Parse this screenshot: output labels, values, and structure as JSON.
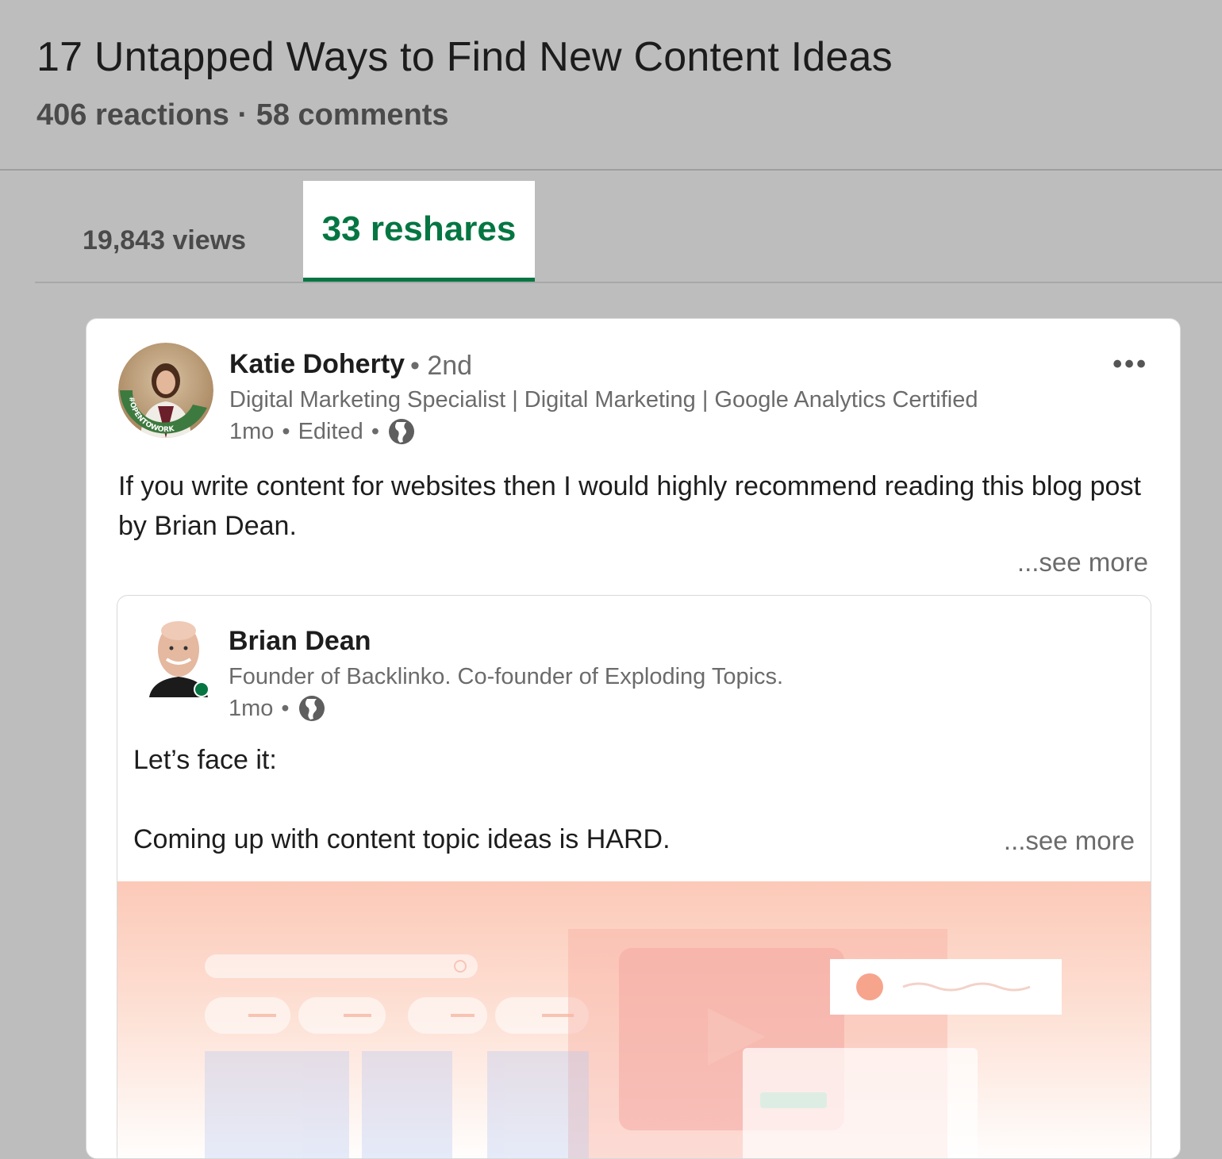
{
  "article": {
    "title": "17 Untapped Ways to Find New Content Ideas",
    "stats": "406 reactions · 58 comments"
  },
  "tabs": {
    "views_label": "19,843 views",
    "reshares_label": "33 reshares",
    "active": "reshares",
    "accent_color": "#057642"
  },
  "reshare": {
    "author": {
      "name": "Katie Doherty",
      "degree": "• 2nd",
      "headline": "Digital Marketing Specialist | Digital Marketing | Google Analytics Certified",
      "time": "1mo",
      "edited": "Edited",
      "badge": "#OPENTOWORK"
    },
    "body": "If you write content for websites then I would highly recommend reading this blog post by Brian Dean.",
    "see_more": "...see more",
    "menu_icon": "more-horizontal-icon",
    "visibility_icon": "globe-icon"
  },
  "shared_post": {
    "author": {
      "name": "Brian Dean",
      "headline": "Founder of Backlinko. Co-founder of Exploding Topics.",
      "time": "1mo",
      "online_status_color": "#057642"
    },
    "line1": "Let’s face it:",
    "line2": "Coming up with content topic ideas is HARD.",
    "see_more": "...see more"
  }
}
